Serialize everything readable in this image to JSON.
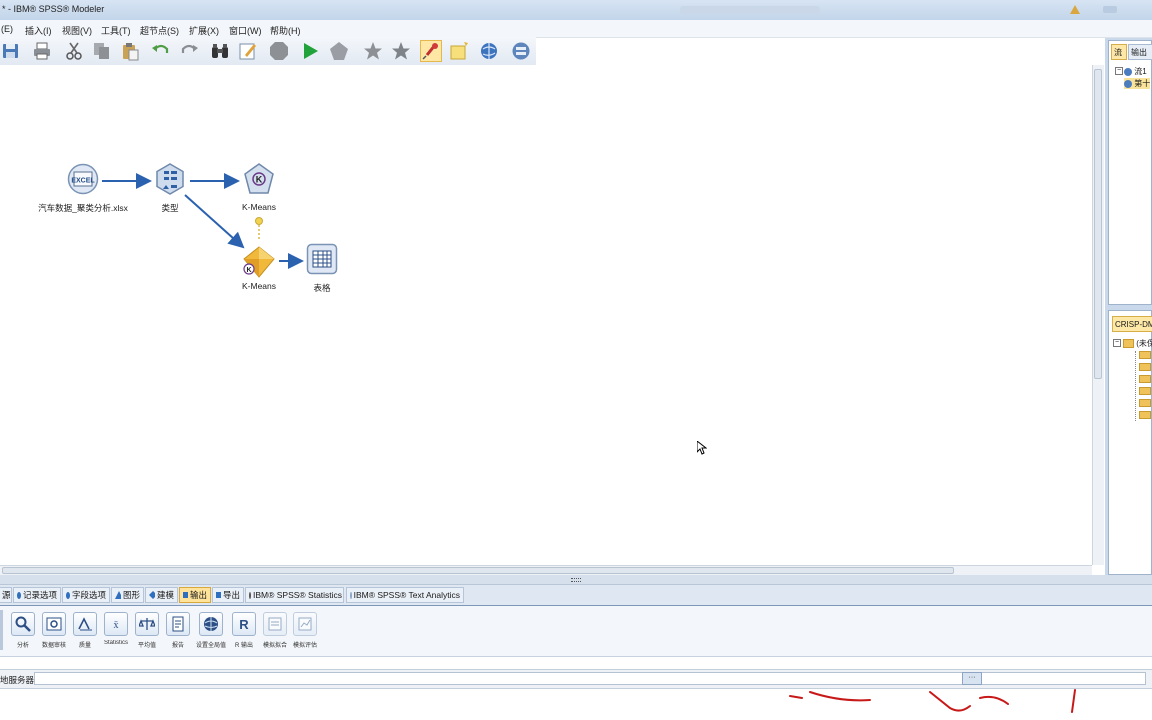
{
  "window": {
    "title": "*  - IBM® SPSS® Modeler"
  },
  "menu": {
    "items": [
      "(E)",
      "插入(I)",
      "视图(V)",
      "工具(T)",
      "超节点(S)",
      "扩展(X)",
      "窗口(W)",
      "帮助(H)"
    ]
  },
  "toolbar": {
    "buttons": [
      "save-icon",
      "print-icon",
      "cut-icon",
      "copy-icon",
      "paste-icon",
      "undo-icon",
      "redo-icon",
      "binoculars-icon",
      "edit-icon",
      "stop-icon",
      "run-icon",
      "run-selection-icon",
      "star-icon",
      "star-outline-icon",
      "pin-icon",
      "comment-icon",
      "globe-icon",
      "server-icon"
    ]
  },
  "stream": {
    "nodes": [
      {
        "id": "excel",
        "label": "汽车数据_聚类分析.xlsx",
        "icon": "excel-source-icon"
      },
      {
        "id": "type",
        "label": "类型",
        "icon": "type-node-icon"
      },
      {
        "id": "kmeans_model",
        "label": "K-Means",
        "icon": "kmeans-modeling-icon"
      },
      {
        "id": "kmeans_nugget",
        "label": "K-Means",
        "icon": "kmeans-nugget-icon"
      },
      {
        "id": "table",
        "label": "表格",
        "icon": "table-icon"
      }
    ]
  },
  "right_panel": {
    "top_tabs": [
      "流",
      "输出"
    ],
    "top_tree": [
      "流1",
      "第十"
    ],
    "bottom_tab": "CRISP-DM",
    "bottom_tree_root": "(未保存)"
  },
  "palette_tabs": [
    {
      "label": "源",
      "active": false
    },
    {
      "label": "记录选项",
      "active": false
    },
    {
      "label": "字段选项",
      "active": false
    },
    {
      "label": "图形",
      "active": false
    },
    {
      "label": "建模",
      "active": false
    },
    {
      "label": "输出",
      "active": true
    },
    {
      "label": "导出",
      "active": false
    },
    {
      "label": "IBM® SPSS® Statistics",
      "active": false
    },
    {
      "label": "IBM® SPSS® Text Analytics",
      "active": false
    }
  ],
  "palette_items": [
    {
      "label": "分析",
      "icon": "magnifier-icon"
    },
    {
      "label": "数据审核",
      "icon": "data-audit-icon"
    },
    {
      "label": "质量",
      "icon": "quality-icon"
    },
    {
      "label": "Statistics",
      "icon": "statistics-icon"
    },
    {
      "label": "平均值",
      "icon": "means-icon"
    },
    {
      "label": "报告",
      "icon": "report-icon"
    },
    {
      "label": "设置全局值",
      "icon": "globe-icon"
    },
    {
      "label": "R 输出",
      "icon": "r-output-icon"
    },
    {
      "label": "模拟拟合",
      "icon": "sim-fit-icon"
    },
    {
      "label": "模拟评估",
      "icon": "sim-eval-icon"
    }
  ],
  "status": {
    "server_label": "地服务器"
  },
  "colors": {
    "accent": "#2f6fc0",
    "active_tab": "#ffe39a",
    "link_arrow": "#2a62b0"
  }
}
